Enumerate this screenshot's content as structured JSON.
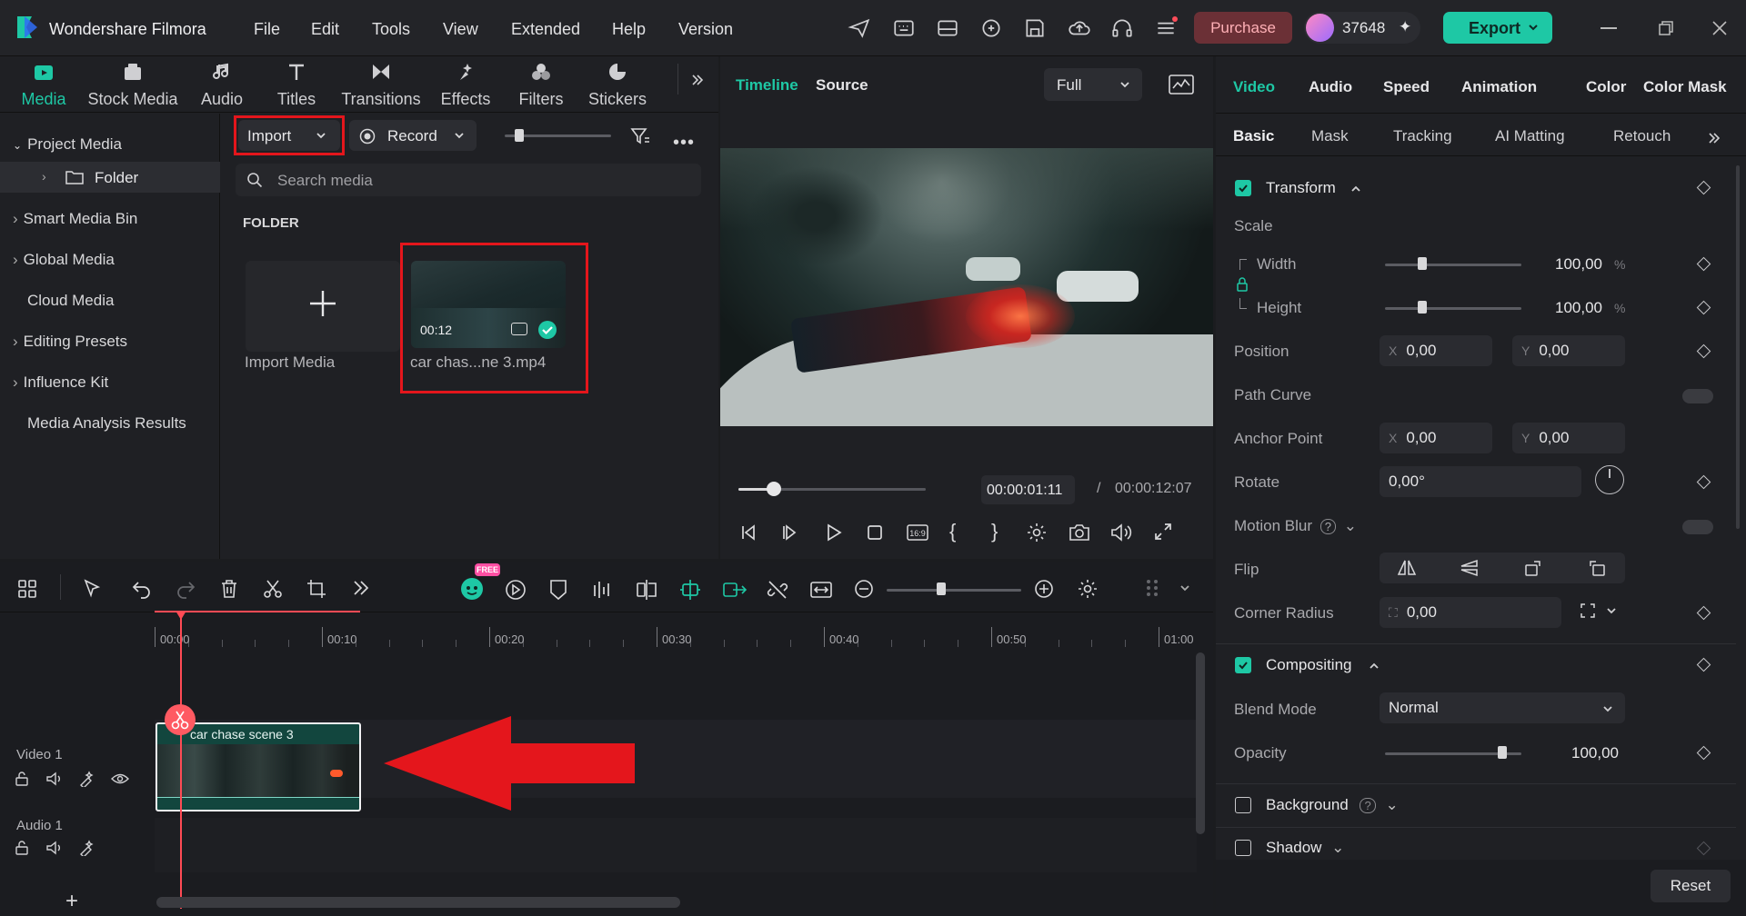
{
  "app": {
    "title": "Wondershare Filmora",
    "menus": [
      "File",
      "Edit",
      "Tools",
      "View",
      "Extended",
      "Help",
      "Version"
    ],
    "purchase": "Purchase",
    "credits": "37648",
    "export": "Export",
    "accent": "#1ec8a5"
  },
  "media_tabs": [
    {
      "label": "Media",
      "icon": "media-icon"
    },
    {
      "label": "Stock Media",
      "icon": "stock-media-icon"
    },
    {
      "label": "Audio",
      "icon": "audio-icon"
    },
    {
      "label": "Titles",
      "icon": "titles-icon"
    },
    {
      "label": "Transitions",
      "icon": "transitions-icon"
    },
    {
      "label": "Effects",
      "icon": "effects-icon"
    },
    {
      "label": "Filters",
      "icon": "filters-icon"
    },
    {
      "label": "Stickers",
      "icon": "stickers-icon"
    }
  ],
  "sidebar": {
    "items": [
      "Project Media",
      "Folder",
      "Smart Media Bin",
      "Global Media",
      "Cloud Media",
      "Editing Presets",
      "Influence Kit",
      "Media Analysis Results"
    ]
  },
  "media": {
    "import": "Import",
    "record": "Record",
    "search_placeholder": "Search media",
    "folder_heading": "FOLDER",
    "import_media": "Import Media",
    "clip_name": "car chas...ne 3.mp4",
    "clip_duration": "00:12"
  },
  "viewer": {
    "tabs": [
      "Timeline",
      "Source"
    ],
    "quality": "Full",
    "current": "00:00:01:11",
    "separator": "/",
    "total": "00:00:12:07",
    "progress": 0.19
  },
  "props": {
    "tabs": [
      "Video",
      "Audio",
      "Speed",
      "Animation",
      "Color",
      "Color Mask"
    ],
    "subtabs": [
      "Basic",
      "Mask",
      "Tracking",
      "AI Matting",
      "Retouch"
    ],
    "transform": "Transform",
    "scale": "Scale",
    "width_label": "Width",
    "height_label": "Height",
    "width_val": "100,00",
    "height_val": "100,00",
    "pct": "%",
    "position": "Position",
    "pos_x": "0,00",
    "pos_y": "0,00",
    "x": "X",
    "y": "Y",
    "path_curve": "Path Curve",
    "anchor": "Anchor Point",
    "anc_x": "0,00",
    "anc_y": "0,00",
    "rotate": "Rotate",
    "rotate_val": "0,00°",
    "motion_blur": "Motion Blur",
    "flip": "Flip",
    "corner_radius": "Corner Radius",
    "corner_val": "0,00",
    "compositing": "Compositing",
    "blend_mode": "Blend Mode",
    "blend_val": "Normal",
    "opacity": "Opacity",
    "opacity_val": "100,00",
    "opacity_level": 0.86,
    "scale_level": 0.27,
    "background": "Background",
    "shadow": "Shadow",
    "reset": "Reset"
  },
  "timeline": {
    "ruler": [
      "00:00",
      "00:10",
      "00:20",
      "00:30",
      "00:40",
      "00:50",
      "01:00"
    ],
    "video_track": "Video 1",
    "audio_track": "Audio 1",
    "clip_title": "car chase scene 3",
    "free_badge": "FREE"
  }
}
